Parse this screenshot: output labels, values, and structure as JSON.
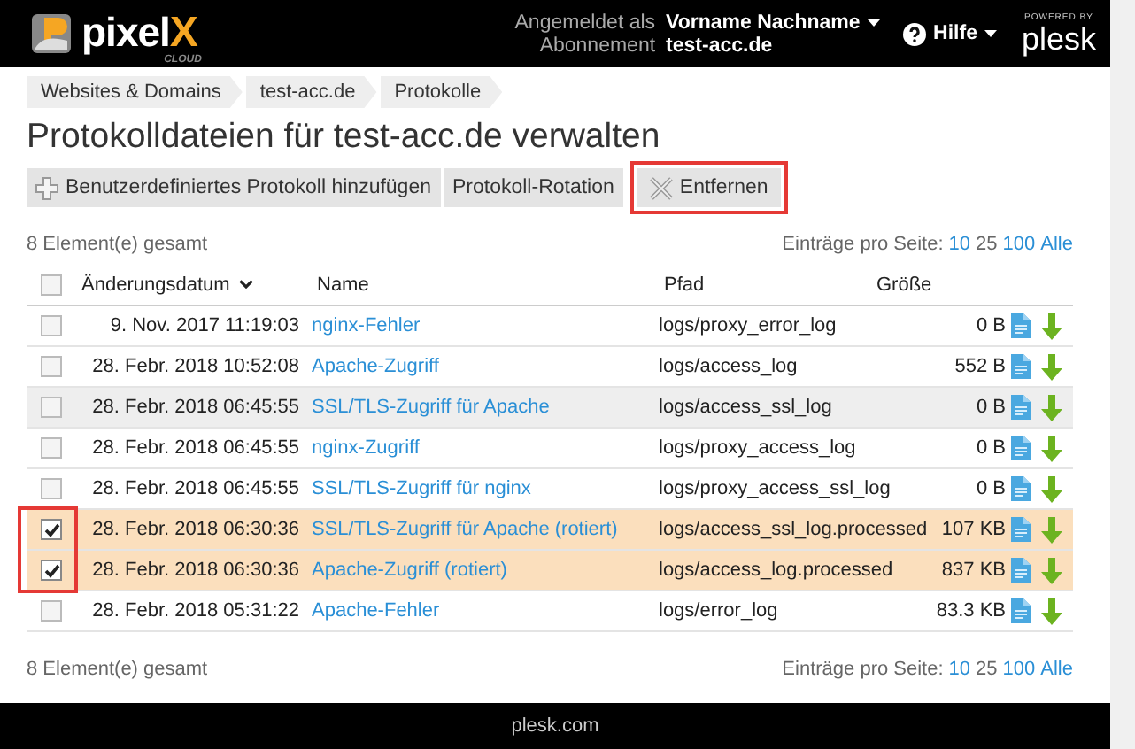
{
  "header": {
    "brand": "pixel",
    "brand_accent": "X",
    "brand_sub": "CLOUD",
    "logged_in_label": "Angemeldet als",
    "user_name": "Vorname Nachname",
    "subscription_label": "Abonnement",
    "subscription": "test-acc.de",
    "help": "Hilfe",
    "powered_by": "POWERED BY",
    "plesk": "plesk"
  },
  "breadcrumbs": [
    "Websites & Domains",
    "test-acc.de",
    "Protokolle"
  ],
  "title": "Protokolldateien für test-acc.de verwalten",
  "toolbar": [
    {
      "label": "Benutzerdefiniertes Protokoll hinzufügen",
      "kind": "add",
      "highlighted": false
    },
    {
      "label": "Protokoll-Rotation",
      "kind": "plain",
      "highlighted": false
    },
    {
      "label": "Entfernen",
      "kind": "remove",
      "highlighted": true
    }
  ],
  "summary_top": "8 Element(e) gesamt",
  "per_page_top": {
    "label": "Einträge pro Seite:",
    "options": [
      {
        "label": "10",
        "selected": false
      },
      {
        "label": "25",
        "selected": true
      },
      {
        "label": "100",
        "selected": false
      },
      {
        "label": "Alle",
        "selected": false
      }
    ]
  },
  "table": {
    "columns": [
      {
        "label": "Änderungsdatum",
        "sorted": true
      },
      {
        "label": "Name",
        "sorted": false
      },
      {
        "label": "Pfad",
        "sorted": false
      },
      {
        "label": "Größe",
        "sorted": false
      }
    ],
    "select_all_checked": false,
    "checkbox_highlight": true,
    "rows": [
      {
        "date": "9. Nov. 2017 11:19:03",
        "name": "nginx-Fehler",
        "path": "logs/proxy_error_log",
        "size": "0 B",
        "selected": false,
        "hovered": false
      },
      {
        "date": "28. Febr. 2018 10:52:08",
        "name": "Apache-Zugriff",
        "path": "logs/access_log",
        "size": "552 B",
        "selected": false,
        "hovered": false
      },
      {
        "date": "28. Febr. 2018 06:45:55",
        "name": "SSL/TLS-Zugriff für Apache",
        "path": "logs/access_ssl_log",
        "size": "0 B",
        "selected": false,
        "hovered": true
      },
      {
        "date": "28. Febr. 2018 06:45:55",
        "name": "nginx-Zugriff",
        "path": "logs/proxy_access_log",
        "size": "0 B",
        "selected": false,
        "hovered": false
      },
      {
        "date": "28. Febr. 2018 06:45:55",
        "name": "SSL/TLS-Zugriff für nginx",
        "path": "logs/proxy_access_ssl_log",
        "size": "0 B",
        "selected": false,
        "hovered": false
      },
      {
        "date": "28. Febr. 2018 06:30:36",
        "name": "SSL/TLS-Zugriff für Apache (rotiert)",
        "path": "logs/access_ssl_log.processed",
        "size": "107 KB",
        "selected": true,
        "hovered": false
      },
      {
        "date": "28. Febr. 2018 06:30:36",
        "name": "Apache-Zugriff (rotiert)",
        "path": "logs/access_log.processed",
        "size": "837 KB",
        "selected": true,
        "hovered": false
      },
      {
        "date": "28. Febr. 2018 05:31:22",
        "name": "Apache-Fehler",
        "path": "logs/error_log",
        "size": "83.3 KB",
        "selected": false,
        "hovered": false
      }
    ]
  },
  "summary_bottom": "8 Element(e) gesamt",
  "per_page_bottom": {
    "label": "Einträge pro Seite:",
    "options": [
      {
        "label": "10",
        "selected": false
      },
      {
        "label": "25",
        "selected": true
      },
      {
        "label": "100",
        "selected": false
      },
      {
        "label": "Alle",
        "selected": false
      }
    ]
  },
  "footer": "plesk.com"
}
